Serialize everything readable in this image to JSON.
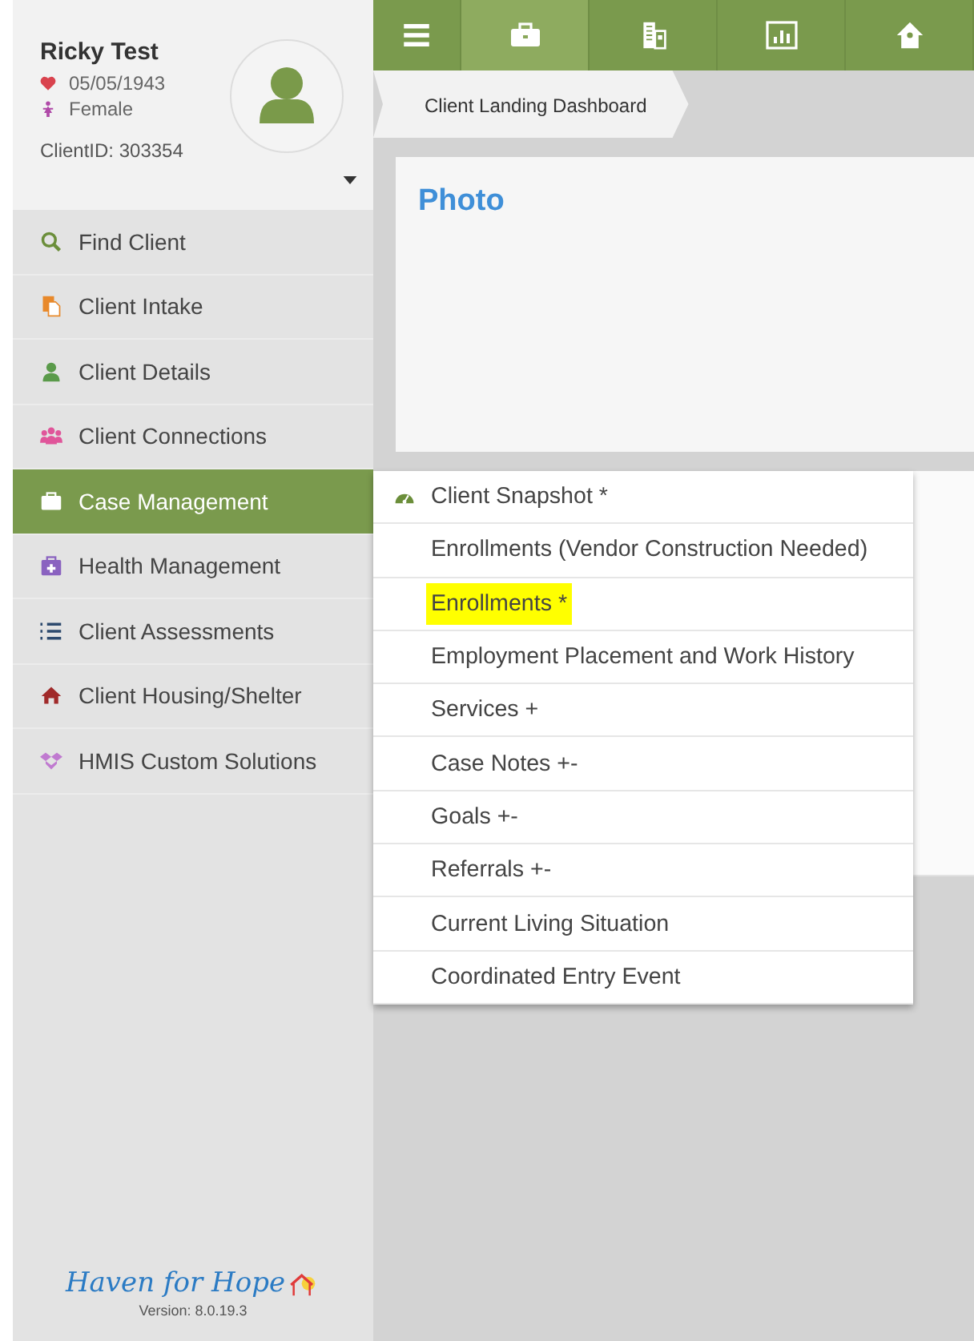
{
  "client": {
    "name": "Ricky Test",
    "dob": "05/05/1943",
    "gender": "Female",
    "client_id": "ClientID: 303354"
  },
  "sidebar": {
    "items": [
      {
        "label": "Find Client",
        "kind": "search",
        "selected": false
      },
      {
        "label": "Client Intake",
        "kind": "intake",
        "selected": false
      },
      {
        "label": "Client Details",
        "kind": "person",
        "selected": false
      },
      {
        "label": "Client Connections",
        "kind": "people",
        "selected": false
      },
      {
        "label": "Case Management",
        "kind": "briefcase",
        "selected": true
      },
      {
        "label": "Health Management",
        "kind": "medkit",
        "selected": false
      },
      {
        "label": "Client Assessments",
        "kind": "list",
        "selected": false
      },
      {
        "label": "Client Housing/Shelter",
        "kind": "house",
        "selected": false
      },
      {
        "label": "HMIS Custom Solutions",
        "kind": "dropbox",
        "selected": false
      }
    ]
  },
  "logo": {
    "text": "Haven for Hope",
    "version": "Version: 8.0.19.3"
  },
  "toolbar": {
    "tabs": [
      {
        "kind": "menu",
        "selected": false
      },
      {
        "kind": "briefcase",
        "selected": true
      },
      {
        "kind": "building",
        "selected": false
      },
      {
        "kind": "chart",
        "selected": false
      },
      {
        "kind": "home",
        "selected": false
      }
    ]
  },
  "breadcrumb": "Client Landing Dashboard",
  "photo_card": {
    "title": "Photo"
  },
  "menu": {
    "items": [
      {
        "label": "Client Snapshot *",
        "kind": "dashboard",
        "highlighted": false
      },
      {
        "label": "Enrollments (Vendor Construction Needed)",
        "kind": "plain",
        "highlighted": false
      },
      {
        "label": "Enrollments *",
        "kind": "plain",
        "highlighted": true
      },
      {
        "label": "Employment Placement and Work History",
        "kind": "plain",
        "highlighted": false
      },
      {
        "label": "Services +",
        "kind": "plain",
        "highlighted": false
      },
      {
        "label": "Case Notes +-",
        "kind": "plain",
        "highlighted": false
      },
      {
        "label": "Goals +-",
        "kind": "plain",
        "highlighted": false
      },
      {
        "label": "Referrals +-",
        "kind": "plain",
        "highlighted": false
      },
      {
        "label": "Current Living Situation",
        "kind": "plain",
        "highlighted": false
      },
      {
        "label": "Coordinated Entry Event",
        "kind": "plain",
        "highlighted": false
      }
    ]
  }
}
